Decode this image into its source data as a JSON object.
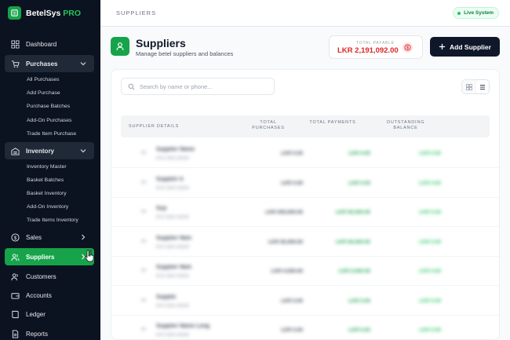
{
  "brand": {
    "name": "BetelSys",
    "suffix": "PRO"
  },
  "nav": {
    "dashboard": "Dashboard",
    "purchases": "Purchases",
    "purchases_sub": [
      "All Purchases",
      "Add Purchase",
      "Purchase Batches",
      "Add-On Purchases",
      "Trade Item Purchase"
    ],
    "inventory": "Inventory",
    "inventory_sub": [
      "Inventory Master",
      "Basket Batches",
      "Basket Inventory",
      "Add-On Inventory",
      "Trade Items Inventory"
    ],
    "sales": "Sales",
    "suppliers": "Suppliers",
    "customers": "Customers",
    "accounts": "Accounts",
    "ledger": "Ledger",
    "reports": "Reports"
  },
  "topbar": {
    "breadcrumb": "SUPPLIERS",
    "status": "Live System"
  },
  "page": {
    "title": "Suppliers",
    "subtitle": "Manage betel suppliers and balances"
  },
  "total_payable": {
    "label": "TOTAL PAYABLE",
    "value": "LKR 2,191,092.00"
  },
  "add_button": "Add Supplier",
  "search": {
    "placeholder": "Search by name or phone...",
    "value": ""
  },
  "table": {
    "headers": {
      "details": "SUPPLIER DETAILS",
      "purchases": "TOTAL PURCHASES",
      "payments": "TOTAL PAYMENTS",
      "balance": "OUTSTANDING BALANCE"
    },
    "rows": [
      {
        "id": "##",
        "name": "Supplier Name",
        "phone": "07X XXX XXXX",
        "purchases": "LKR 0.00",
        "payments": "LKR 0.00",
        "balance": "LKR 0.00"
      },
      {
        "id": "##",
        "name": "Supplier A",
        "phone": "07X XXX XXXX",
        "purchases": "LKR 0.00",
        "payments": "LKR 0.00",
        "balance": "LKR 0.00"
      },
      {
        "id": "##",
        "name": "Sup",
        "phone": "07X XXX XXXX",
        "purchases": "LKR 000,000.00",
        "payments": "LKR 00,000.00",
        "balance": "LKR 0.00"
      },
      {
        "id": "##",
        "name": "Supplier Nam",
        "phone": "07X XXX XXXX",
        "purchases": "LKR 00,000.00",
        "payments": "LKR 00,000.00",
        "balance": "LKR 0.00"
      },
      {
        "id": "##",
        "name": "Supplier Nam",
        "phone": "07X XXX XXXX",
        "purchases": "LKR 0,000.00",
        "payments": "LKR 0,000.00",
        "balance": "LKR 0.00"
      },
      {
        "id": "##",
        "name": "Supplie",
        "phone": "07X XXX XXXX",
        "purchases": "LKR 0.00",
        "payments": "LKR 0.00",
        "balance": "LKR 0.00"
      },
      {
        "id": "##",
        "name": "Supplier Name Long",
        "phone": "07X XXX XXXX",
        "purchases": "LKR 0.00",
        "payments": "LKR 0.00",
        "balance": "LKR 0.00"
      }
    ]
  },
  "colors": {
    "accent": "#16a34a",
    "sidebar": "#0b1220",
    "danger": "#dc2626"
  }
}
